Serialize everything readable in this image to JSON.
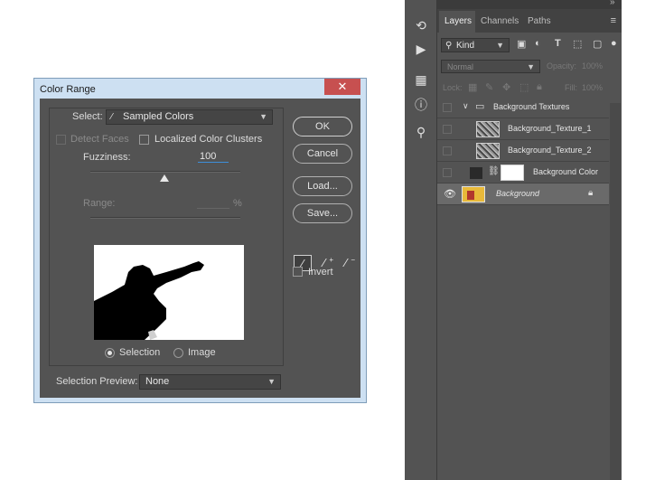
{
  "dialog": {
    "title": "Color Range",
    "close_symbol": "✕",
    "select_label": "Select:",
    "select_value": "Sampled Colors",
    "detect_faces": "Detect Faces",
    "localized_clusters": "Localized Color Clusters",
    "fuzziness_label": "Fuzziness:",
    "fuzziness_value": "100",
    "range_label": "Range:",
    "range_value": "",
    "range_unit": "%",
    "radio_selection": "Selection",
    "radio_image": "Image",
    "selection_preview_label": "Selection Preview:",
    "selection_preview_value": "None",
    "buttons": {
      "ok": "OK",
      "cancel": "Cancel",
      "load": "Load...",
      "save": "Save..."
    },
    "invert": "Invert",
    "eyedroppers": [
      "eyedropper-icon",
      "eyedropper-add-icon",
      "eyedropper-subtract-icon"
    ]
  },
  "panel": {
    "collapse_left": "«",
    "collapse_right": "»",
    "tabs": [
      "Layers",
      "Channels",
      "Paths"
    ],
    "filter_kind": "Kind",
    "blend_mode": "Normal",
    "opacity_label": "Opacity:",
    "opacity_value": "100%",
    "lock_label": "Lock:",
    "fill_label": "Fill:",
    "fill_value": "100%",
    "layers": [
      {
        "name": "Background Textures"
      },
      {
        "name": "Background_Texture_1"
      },
      {
        "name": "Background_Texture_2"
      },
      {
        "name": "Background Color"
      },
      {
        "name": "Background"
      }
    ]
  },
  "colors": {
    "accent": "#3d8fd9",
    "dialog_bg": "#535353",
    "panel_bg": "#535353"
  }
}
